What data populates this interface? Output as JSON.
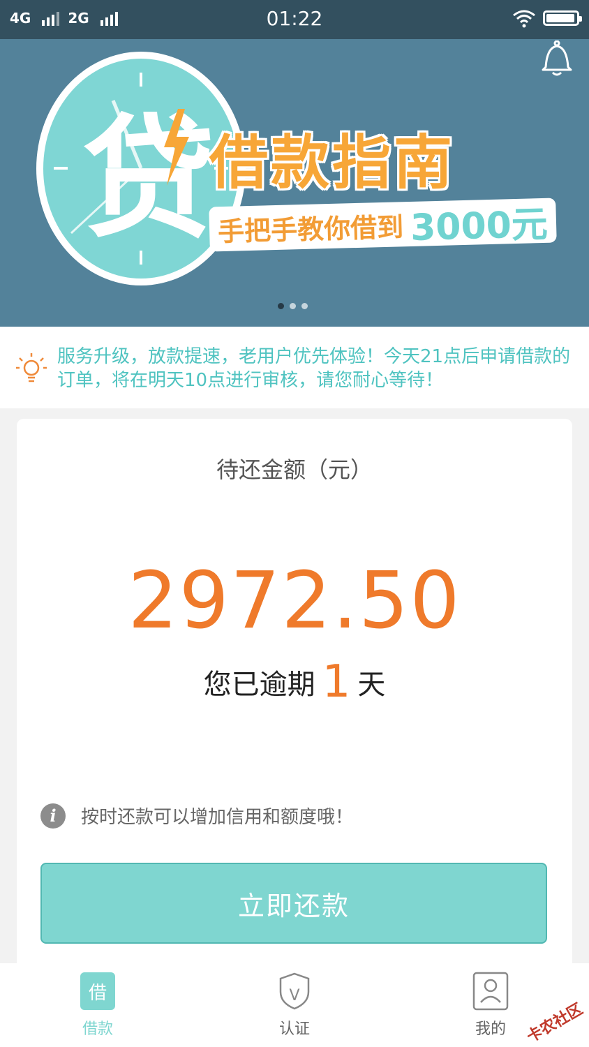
{
  "status_bar": {
    "network1": "4G",
    "network2": "2G",
    "time": "01:22",
    "battery_level": 0.95
  },
  "banner": {
    "logo_char": "贷",
    "title": "借款指南",
    "subtitle": "手把手教你借到",
    "amount": "3000元",
    "page_count": 3,
    "active_page": 1
  },
  "notice": {
    "icon": "lightbulb-icon",
    "text": "服务升级，放款提速，老用户优先体验！今天21点后申请借款的订单，将在明天10点进行审核，请您耐心等待！"
  },
  "repayment": {
    "label": "待还金额（元）",
    "amount": "2972.50",
    "overdue_prefix": "您已逾期",
    "overdue_days": "1",
    "overdue_suffix": "天",
    "tip_icon": "info-icon",
    "tip": "按时还款可以增加信用和额度哦！",
    "button": "立即还款"
  },
  "tabbar": {
    "tabs": [
      {
        "label": "借款",
        "icon_text": "借",
        "icon": "borrow-icon",
        "active": true
      },
      {
        "label": "认证",
        "icon_text": "V",
        "icon": "shield-icon",
        "active": false
      },
      {
        "label": "我的",
        "icon": "user-icon",
        "active": false
      }
    ]
  },
  "watermark": "卡农社区",
  "colors": {
    "accent": "#7fd6d0",
    "amount": "#ef7a2b",
    "notice_text": "#4fc3c0",
    "status_bar": "#33505f",
    "banner_bg": "#53829a"
  }
}
